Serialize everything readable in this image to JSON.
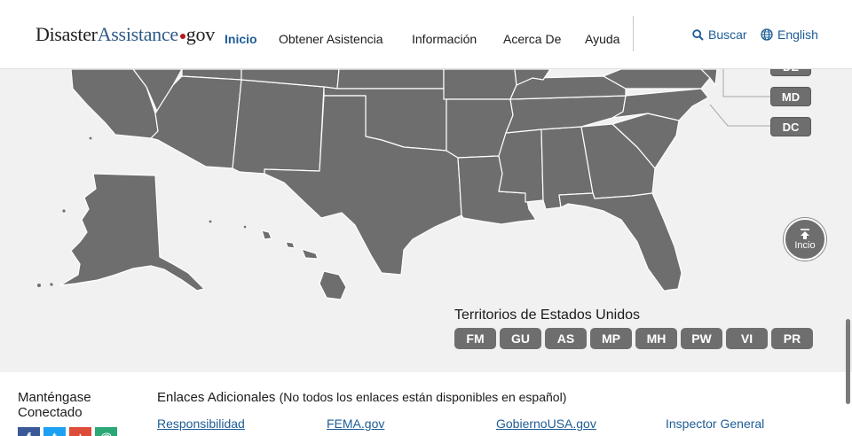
{
  "header": {
    "logo": {
      "part1": "Disaster",
      "part2": "Assistance",
      "part3": "gov"
    },
    "nav": [
      {
        "label": "Inicio",
        "active": true
      },
      {
        "label": "Obtener Asistencia",
        "active": false
      },
      {
        "label": "Información",
        "active": false
      },
      {
        "label": "Acerca De",
        "active": false
      },
      {
        "label": "Ayuda",
        "active": false
      }
    ],
    "search_label": "Buscar",
    "language_label": "English"
  },
  "map": {
    "state_buttons": [
      "DE",
      "MD",
      "DC"
    ],
    "back_to_top_label": "Incio",
    "territories_title": "Territorios de Estados Unidos",
    "territories": [
      "FM",
      "GU",
      "AS",
      "MP",
      "MH",
      "PW",
      "VI",
      "PR"
    ]
  },
  "footer": {
    "connect_title": "Manténgase Conectado",
    "social": [
      {
        "name": "facebook-icon",
        "glyph": "f",
        "color": "#3b5998"
      },
      {
        "name": "twitter-icon",
        "glyph": "t",
        "color": "#1da1f2"
      },
      {
        "name": "google-plus-icon",
        "glyph": "+",
        "color": "#dd4b39"
      },
      {
        "name": "email-icon",
        "glyph": "@",
        "color": "#2aa876"
      }
    ],
    "links_title": "Enlaces Adicionales",
    "links_note": "(No todos los enlaces están disponibles en español)",
    "links": [
      "Responsibilidad",
      "FEMA.gov",
      "GobiernoUSA.gov",
      "Inspector General"
    ]
  },
  "colors": {
    "map_fill": "#6e6e6e",
    "map_border": "#ffffff",
    "page_background": "#f1f1f1",
    "link": "#1d5c96",
    "logo_blue": "#2e5a88",
    "logo_dot": "#b31b1b"
  }
}
